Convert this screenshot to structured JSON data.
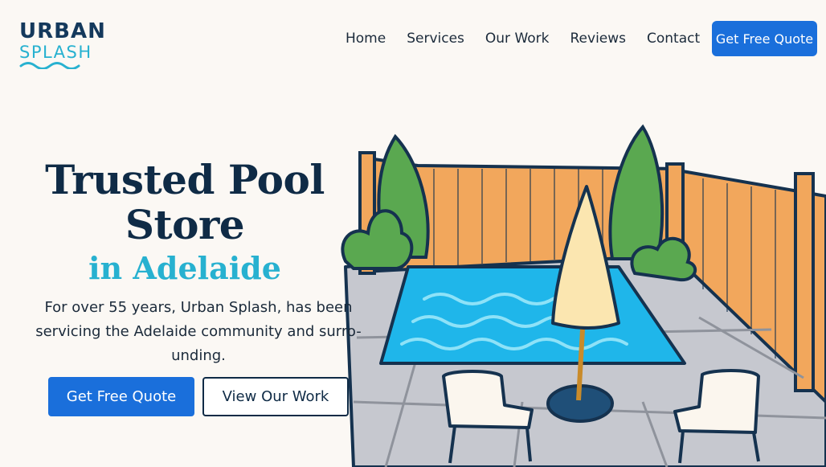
{
  "brand": {
    "logo_line1": "URBAN",
    "logo_line2": "SPLASH"
  },
  "nav": {
    "items": [
      {
        "label": "Home"
      },
      {
        "label": "Services"
      },
      {
        "label": "Our Work"
      },
      {
        "label": "Reviews"
      },
      {
        "label": "Contact"
      }
    ],
    "cta_label": "Get Free Quote"
  },
  "hero": {
    "title_line1": "Trusted Pool",
    "title_line2": "Store",
    "subtitle": "in Adelaide",
    "description_line1": "For over 55 years, Urban Splash, has been",
    "description_line2": "servicing the Adelaide community and surro-",
    "description_line3": "unding.",
    "primary_button": "Get Free Quote",
    "secondary_button": "View Our Work"
  },
  "colors": {
    "brand_navy": "#14395c",
    "brand_aqua": "#27b1d0",
    "accent_blue": "#1a6fdb",
    "pool_blue": "#1fb6ea",
    "fence_orange": "#f2a75c",
    "shrub_green": "#5aa850"
  },
  "icons": {
    "logo_wave": "wave-icon"
  }
}
